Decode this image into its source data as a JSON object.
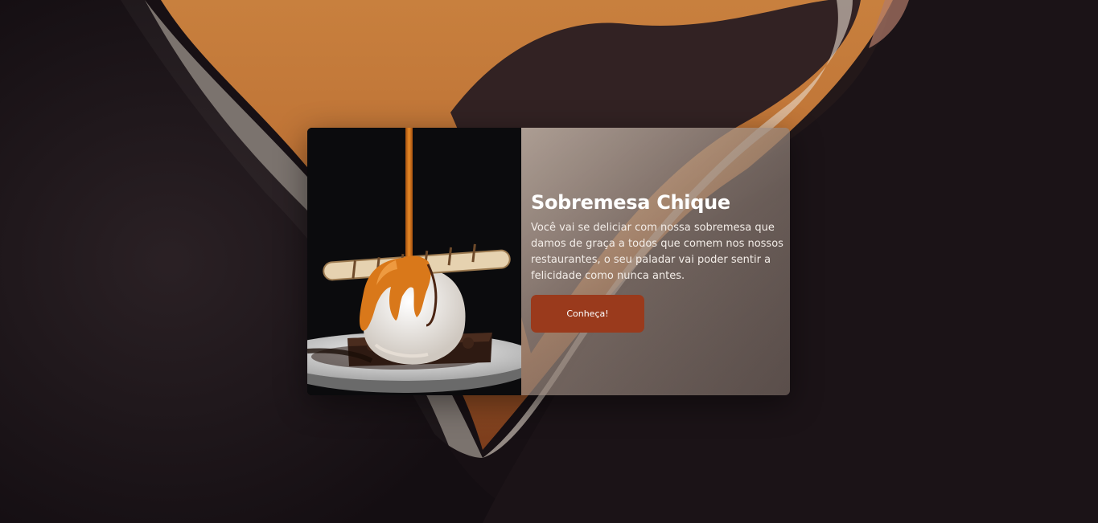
{
  "card": {
    "title": "Sobremesa Chique",
    "description": "Você vai se deliciar com nossa sobremesa que damos de graça a todos que comem nos nossos restaurantes, o seu paladar vai poder sentir a felicidade como nunca antes.",
    "cta_label": "Conheça!",
    "image_alt": "Sobremesa com sorvete, brownie e calda de caramelo"
  },
  "colors": {
    "background": "#1a1216",
    "accent_orange": "#c8803e",
    "button": "#9a3a1c",
    "text": "#ffffff"
  }
}
